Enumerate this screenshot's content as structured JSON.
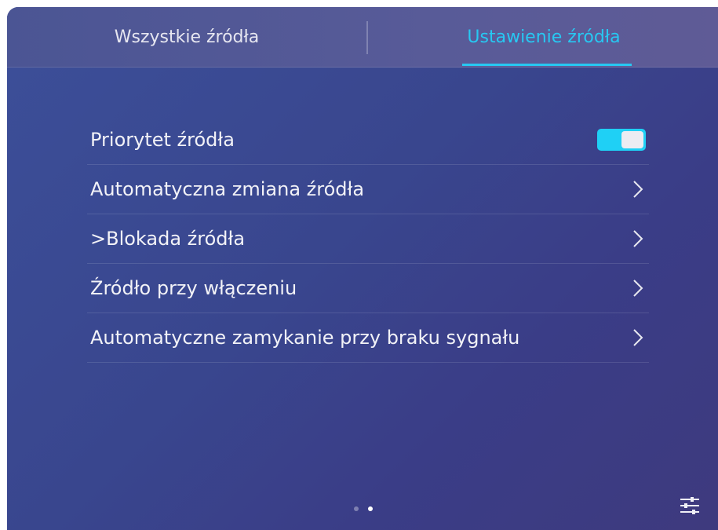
{
  "tabs": {
    "all_label": "Wszystkie źródła",
    "setup_label": "Ustawienie źródła",
    "active": "setup"
  },
  "settings_list": [
    {
      "label": "Priorytet źródła",
      "control": "toggle",
      "toggle_on": true
    },
    {
      "label": "Automatyczna zmiana źródła",
      "control": "chevron-right-icon"
    },
    {
      "label": ">Blokada źródła",
      "control": "chevron-right-icon"
    },
    {
      "label": "Źródło przy włączeniu",
      "control": "chevron-right-icon"
    },
    {
      "label": "Automatyczne zamykanie przy braku sygnału",
      "control": "chevron-right-icon"
    }
  ],
  "pagination": {
    "total": 2,
    "current": 2
  },
  "icons": {
    "settings": "sliders-icon",
    "row_arrow": "chevron-right-icon"
  },
  "colors": {
    "accent": "#27c8f2",
    "toggle_on": "#1fd0f5",
    "text": "#f2f2f7",
    "background": "#3a4690"
  }
}
